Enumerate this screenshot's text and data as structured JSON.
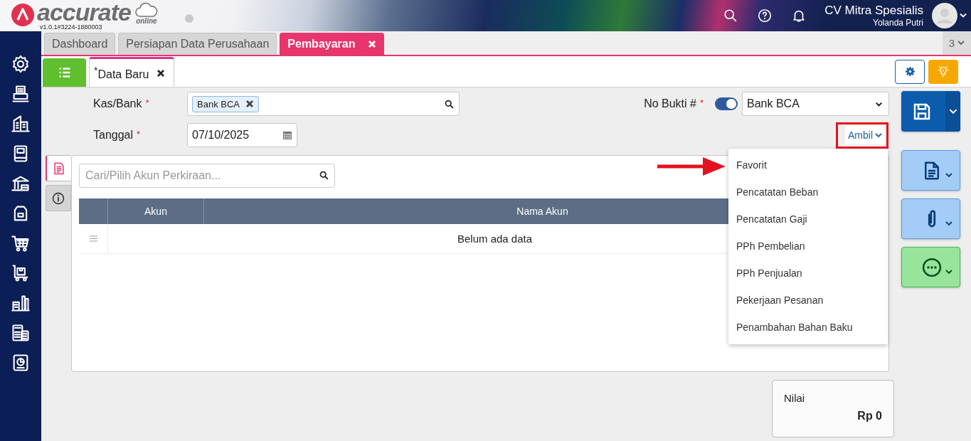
{
  "app": {
    "logo_text": "accurate",
    "logo_sub": "online",
    "version": "v1.0.1#3224-1880003"
  },
  "header": {
    "company": "CV Mitra Spesialis",
    "user": "Yolanda Putri"
  },
  "tabs": [
    {
      "label": "Dashboard",
      "selected": false,
      "closable": false
    },
    {
      "label": "Persiapan Data Perusahaan",
      "selected": false,
      "closable": false
    },
    {
      "label": "Pembayaran",
      "selected": true,
      "closable": true
    }
  ],
  "tab_overflow": {
    "count": "3"
  },
  "subtabs": [
    {
      "label": "Data Baru",
      "marker": "*",
      "selected": true
    }
  ],
  "form": {
    "kas_bank": {
      "label": "Kas/Bank",
      "required_mark": "*",
      "tags": [
        "Bank BCA"
      ]
    },
    "tanggal": {
      "label": "Tanggal",
      "required_mark": "*",
      "value": "07/10/2025"
    },
    "no_bukti": {
      "label": "No Bukti #",
      "required_mark": "*",
      "auto": true,
      "value": "Bank BCA"
    },
    "ambil": {
      "label": "Ambil",
      "expanded": true
    }
  },
  "side_tabs": [
    {
      "kind": "detail",
      "selected": true
    },
    {
      "kind": "info",
      "selected": false
    }
  ],
  "search": {
    "placeholder": "Cari/Pilih Akun Perkiraan..."
  },
  "table": {
    "columns": [
      "Akun",
      "Nama Akun"
    ],
    "empty_text": "Belum ada data"
  },
  "dropdown": [
    "Favorit",
    "Pencatatan Beban",
    "Pencatatan Gaji",
    "PPh Pembelian",
    "PPh Penjualan",
    "Pekerjaan Pesanan",
    "Penambahan Bahan Baku"
  ],
  "total": {
    "label": "Nilai",
    "value": "Rp 0"
  }
}
